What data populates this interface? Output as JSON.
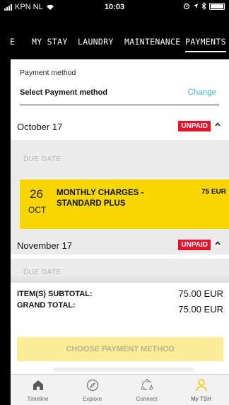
{
  "status": {
    "carrier": "KPN NL",
    "time": "10:03"
  },
  "tabs": [
    {
      "label": "E"
    },
    {
      "label": "MY STAY"
    },
    {
      "label": "LAUNDRY"
    },
    {
      "label": "MAINTENANCE"
    },
    {
      "label": "PAYMENTS",
      "active": true
    }
  ],
  "payment_method": {
    "label": "Payment method",
    "value": "Select Payment method",
    "change_label": "Change"
  },
  "months": [
    {
      "name": "October 17",
      "status": "UNPAID",
      "due_label": "DUE DATE",
      "charge": {
        "day": "26",
        "month": "OCT",
        "title": "MONTHLY CHARGES - STANDARD PLUS",
        "amount": "75 EUR"
      }
    },
    {
      "name": "November 17",
      "status": "UNPAID",
      "due_label": "DUE DATE"
    }
  ],
  "totals": {
    "subtotal_label": "ITEM(S) SUBTOTAL:",
    "subtotal_value": "75.00 EUR",
    "grand_label": "GRAND TOTAL:",
    "grand_value": "75.00 EUR",
    "button_label": "CHOOSE PAYMENT METHOD"
  },
  "bottom_nav": [
    {
      "label": "Timeline",
      "icon": "home-icon"
    },
    {
      "label": "Explore",
      "icon": "compass-icon"
    },
    {
      "label": "Connect",
      "icon": "connect-icon"
    },
    {
      "label": "My TSH",
      "icon": "person-icon",
      "active": true
    }
  ],
  "colors": {
    "accent_yellow": "#f8d600",
    "unpaid_red": "#e3122b",
    "link_teal": "#4fb3c9",
    "active_nav": "#f5c400"
  }
}
